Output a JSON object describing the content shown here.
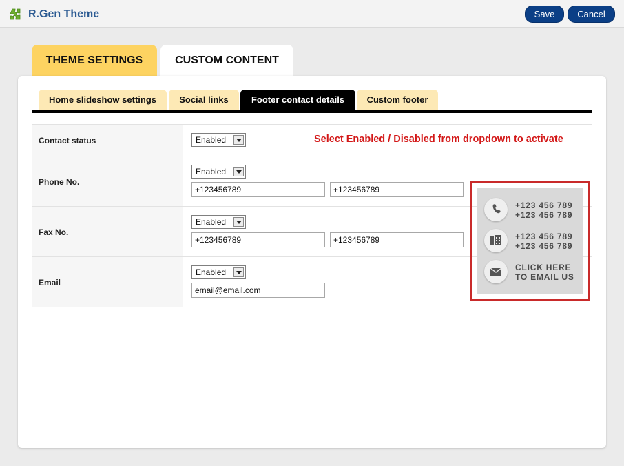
{
  "app": {
    "title": "R.Gen Theme",
    "logo_icon": "puzzle-icon",
    "logo_color": "#6fae2e"
  },
  "toolbar": {
    "save_label": "Save",
    "cancel_label": "Cancel",
    "button_color": "#0b3f86"
  },
  "main_tabs": [
    {
      "label": "THEME SETTINGS",
      "active": false
    },
    {
      "label": "CUSTOM CONTENT",
      "active": true
    }
  ],
  "sub_tabs": [
    {
      "label": "Home slideshow settings",
      "active": false
    },
    {
      "label": "Social links",
      "active": false
    },
    {
      "label": "Footer contact details",
      "active": true
    },
    {
      "label": "Custom footer",
      "active": false
    }
  ],
  "hint": "Select Enabled / Disabled from dropdown to activate",
  "form": {
    "contact_status": {
      "label": "Contact status",
      "status": "Enabled"
    },
    "phone": {
      "label": "Phone No.",
      "status": "Enabled",
      "value1": "+123456789",
      "value2": "+123456789"
    },
    "fax": {
      "label": "Fax No.",
      "status": "Enabled",
      "value1": "+123456789",
      "value2": "+123456789"
    },
    "email": {
      "label": "Email",
      "status": "Enabled",
      "value": "email@email.com"
    }
  },
  "preview": {
    "phone_lines": [
      "+123 456 789",
      "+123 456 789"
    ],
    "fax_lines": [
      "+123 456 789",
      "+123 456 789"
    ],
    "email_lines": [
      "CLICK HERE",
      "TO EMAIL US"
    ],
    "frame_color": "#c92a2a"
  }
}
